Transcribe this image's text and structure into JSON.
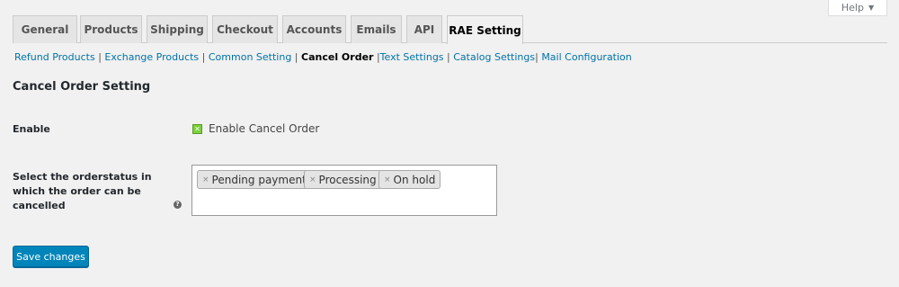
{
  "help": {
    "label": "Help",
    "caret": "▼"
  },
  "tabs": [
    {
      "label": "General"
    },
    {
      "label": "Products"
    },
    {
      "label": "Shipping"
    },
    {
      "label": "Checkout"
    },
    {
      "label": "Accounts"
    },
    {
      "label": "Emails"
    },
    {
      "label": "API"
    },
    {
      "label": "RAE Setting"
    }
  ],
  "subnav": [
    {
      "label": "Refund Products",
      "sep": " | "
    },
    {
      "label": "Exchange Products",
      "sep": " | "
    },
    {
      "label": "Common Setting",
      "sep": " |"
    },
    {
      "label": "Cancel Order",
      "sep": " |"
    },
    {
      "label": "Text Settings",
      "sep": " | "
    },
    {
      "label": "Catalog Settings",
      "sep": "| "
    },
    {
      "label": "Mail Configuration",
      "sep": ""
    }
  ],
  "section": {
    "title": "Cancel Order Setting"
  },
  "enable": {
    "label": "Enable",
    "checkbox_label": "Enable Cancel Order",
    "checkbox_mark": "✕"
  },
  "orderstatus": {
    "label_lines": [
      "Select the orderstatus in",
      "which the order can be",
      "cancelled"
    ],
    "tip": "?",
    "remove": "×",
    "chips": [
      {
        "label": "Pending payment"
      },
      {
        "label": "Processing"
      },
      {
        "label": "On hold"
      }
    ]
  },
  "save": {
    "label": "Save changes"
  },
  "colors": {
    "accent": "#0085ba",
    "link": "#0073aa",
    "check": "#7ad03a"
  }
}
